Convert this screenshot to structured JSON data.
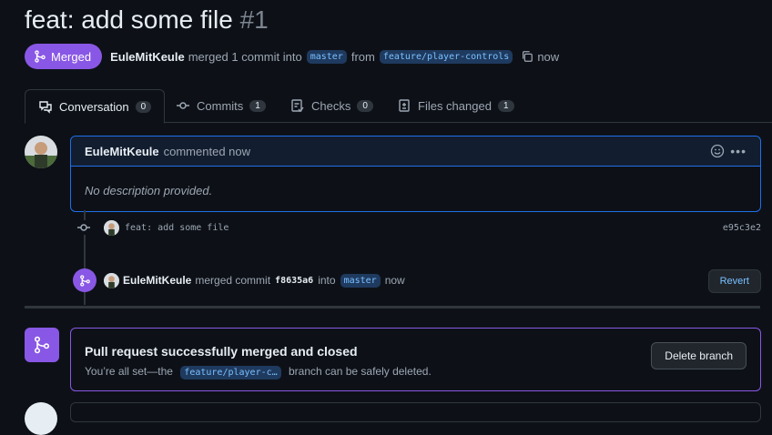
{
  "pr": {
    "title": "feat: add some file",
    "number": "#1"
  },
  "status": {
    "badge": "Merged",
    "author": "EuleMitKeule",
    "text1": "merged 1 commit into",
    "base_branch": "master",
    "text2": "from",
    "head_branch": "feature/player-controls",
    "time": "now"
  },
  "tabs": [
    {
      "label": "Conversation",
      "count": "0"
    },
    {
      "label": "Commits",
      "count": "1"
    },
    {
      "label": "Checks",
      "count": "0"
    },
    {
      "label": "Files changed",
      "count": "1"
    }
  ],
  "comment": {
    "author": "EuleMitKeule",
    "action": "commented now",
    "body": "No description provided."
  },
  "commit": {
    "message": "feat: add some file",
    "sha": "e95c3e2"
  },
  "merge_event": {
    "author": "EuleMitKeule",
    "text": "merged commit",
    "sha": "f8635a6",
    "into": "into",
    "branch": "master",
    "time": "now",
    "revert_label": "Revert"
  },
  "merge_box": {
    "title": "Pull request successfully merged and closed",
    "desc_prefix": "You’re all set—the",
    "branch": "feature/player-c…",
    "desc_suffix": "branch can be safely deleted.",
    "delete_label": "Delete branch"
  },
  "colors": {
    "merged": "#8957e5",
    "accent": "#1f6feb",
    "bg": "#0d1117"
  }
}
